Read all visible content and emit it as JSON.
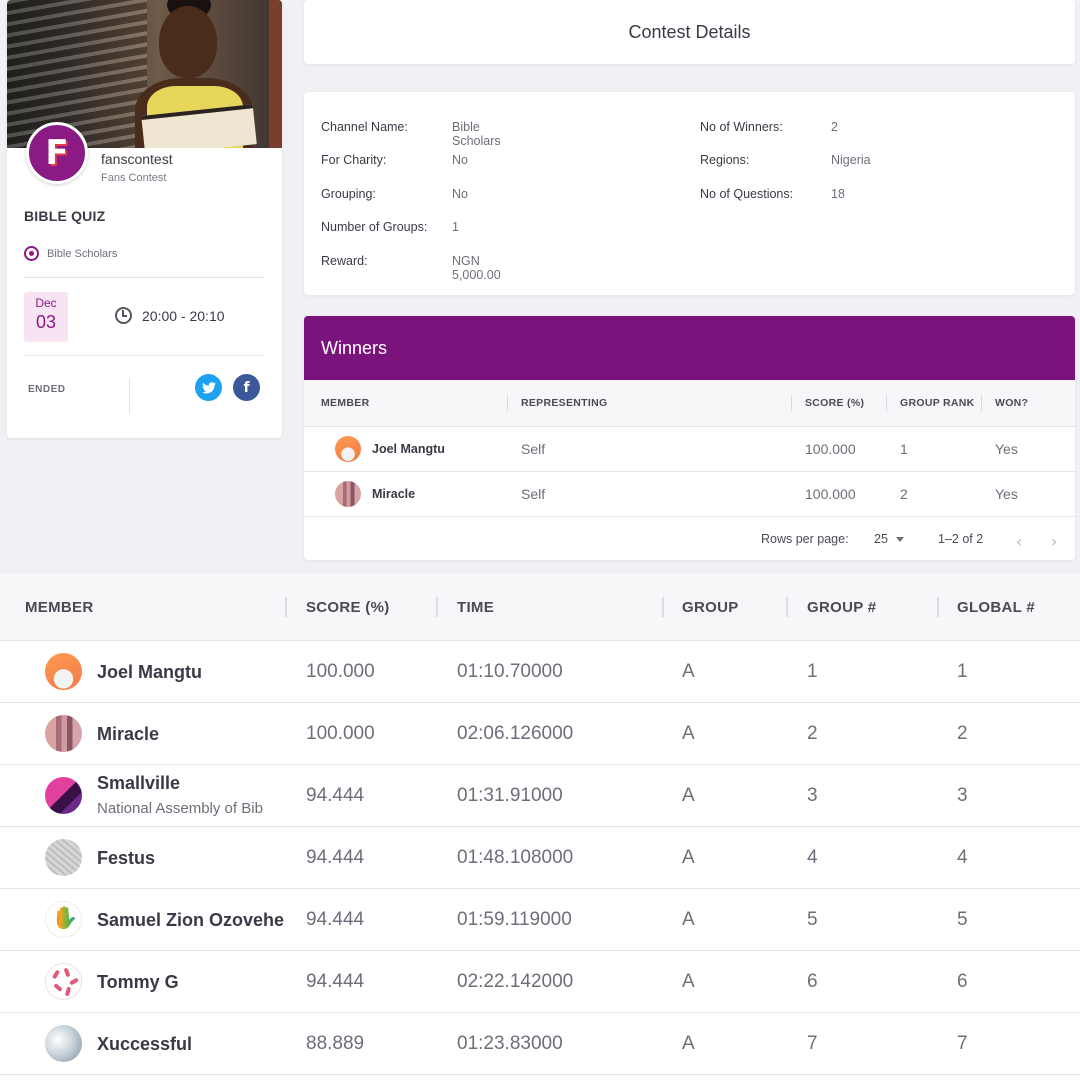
{
  "event_card": {
    "channel_name": "fanscontest",
    "channel_subtitle": "Fans Contest",
    "logo_letter": "F",
    "quiz_title": "BIBLE QUIZ",
    "podcast_label": "Bible Scholars",
    "date_month": "Dec",
    "date_day": "03",
    "time_range": "20:00 - 20:10",
    "status": "ENDED",
    "twitter_glyph": "t",
    "facebook_glyph": "f"
  },
  "contest_details": {
    "title": "Contest Details",
    "left": [
      {
        "label": "Channel Name:",
        "value": "Bible Scholars"
      },
      {
        "label": "For Charity:",
        "value": "No"
      },
      {
        "label": "Grouping:",
        "value": "No"
      },
      {
        "label": "Number of Groups:",
        "value": "1"
      },
      {
        "label": "Reward:",
        "value": "NGN 5,000.00"
      }
    ],
    "right": [
      {
        "label": "No of Winners:",
        "value": "2"
      },
      {
        "label": "Regions:",
        "value": "Nigeria"
      },
      {
        "label": "No of Questions:",
        "value": "18"
      }
    ]
  },
  "winners": {
    "title": "Winners",
    "columns": [
      "MEMBER",
      "REPRESENTING",
      "SCORE (%)",
      "GROUP RANK",
      "WON?"
    ],
    "rows": [
      {
        "member": "Joel Mangtu",
        "representing": "Self",
        "score": "100.000",
        "group_rank": "1",
        "won": "Yes"
      },
      {
        "member": "Miracle",
        "representing": "Self",
        "score": "100.000",
        "group_rank": "2",
        "won": "Yes"
      }
    ],
    "rows_per_page_label": "Rows per page:",
    "rows_per_page_value": "25",
    "range_label": "1–2 of 2",
    "prev_glyph": "‹",
    "next_glyph": "›"
  },
  "leaderboard": {
    "columns": [
      "MEMBER",
      "SCORE (%)",
      "TIME",
      "GROUP",
      "GROUP #",
      "GLOBAL #"
    ],
    "rows": [
      {
        "member": "Joel Mangtu",
        "subtitle": "",
        "score": "100.000",
        "time": "01:10.70000",
        "group": "A",
        "group_no": "1",
        "global_no": "1"
      },
      {
        "member": "Miracle",
        "subtitle": "",
        "score": "100.000",
        "time": "02:06.126000",
        "group": "A",
        "group_no": "2",
        "global_no": "2"
      },
      {
        "member": "Smallville",
        "subtitle": "National Assembly of Bib",
        "score": "94.444",
        "time": "01:31.91000",
        "group": "A",
        "group_no": "3",
        "global_no": "3"
      },
      {
        "member": "Festus",
        "subtitle": "",
        "score": "94.444",
        "time": "01:48.108000",
        "group": "A",
        "group_no": "4",
        "global_no": "4"
      },
      {
        "member": "Samuel Zion Ozovehe",
        "subtitle": "",
        "score": "94.444",
        "time": "01:59.119000",
        "group": "A",
        "group_no": "5",
        "global_no": "5"
      },
      {
        "member": "Tommy G",
        "subtitle": "",
        "score": "94.444",
        "time": "02:22.142000",
        "group": "A",
        "group_no": "6",
        "global_no": "6"
      },
      {
        "member": "Xuccessful",
        "subtitle": "",
        "score": "88.889",
        "time": "01:23.83000",
        "group": "A",
        "group_no": "7",
        "global_no": "7"
      }
    ]
  },
  "colors": {
    "brand_purple": "#7b137c",
    "date_bg": "#f6e4f3",
    "twitter": "#1da1f2",
    "facebook": "#3b5998"
  }
}
